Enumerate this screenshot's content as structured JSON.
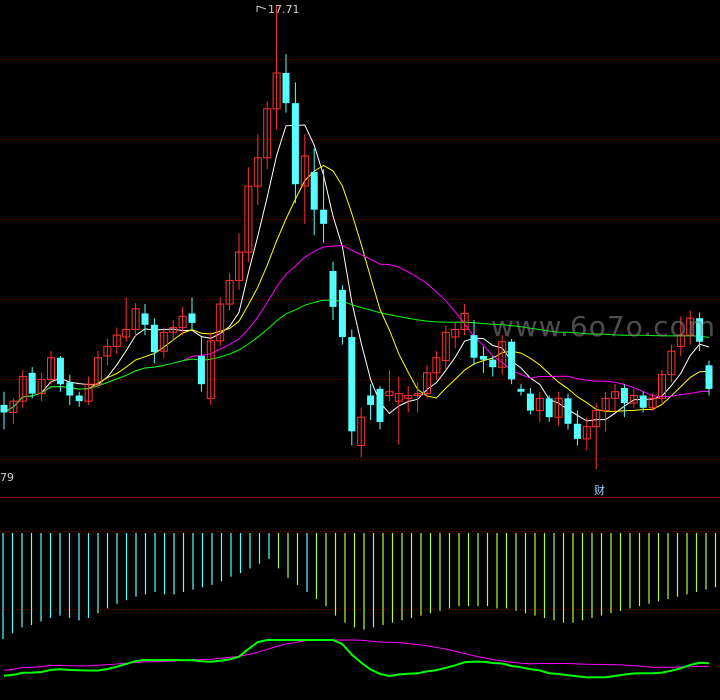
{
  "labels": {
    "high_marker": "17.71",
    "low_marker": "79",
    "event_badge": "财",
    "watermark": "www.6o7o.com"
  },
  "colors": {
    "background": "#000000",
    "grid": "#7a0000",
    "up": "#ff3232",
    "down": "#54ffff",
    "ma5": "#ffffff",
    "ma10": "#ffff00",
    "ma20": "#ff00ff",
    "ma60": "#00ff00",
    "hist_pos": "#adff2f",
    "hist_neg": "#54ffff",
    "sub_line1": "#00ff00",
    "sub_line2": "#ff00ff"
  },
  "chart_data": {
    "type": "candlestick",
    "price_range": [
      12.79,
      17.71
    ],
    "ohlc": [
      [
        13.48,
        13.62,
        13.22,
        13.4
      ],
      [
        13.4,
        13.55,
        13.28,
        13.52
      ],
      [
        13.52,
        13.85,
        13.45,
        13.78
      ],
      [
        13.82,
        13.88,
        13.55,
        13.6
      ],
      [
        13.6,
        13.82,
        13.52,
        13.75
      ],
      [
        13.75,
        14.05,
        13.7,
        13.98
      ],
      [
        13.98,
        14.0,
        13.62,
        13.7
      ],
      [
        13.72,
        13.8,
        13.48,
        13.58
      ],
      [
        13.58,
        13.62,
        13.46,
        13.52
      ],
      [
        13.52,
        13.78,
        13.48,
        13.7
      ],
      [
        13.7,
        14.05,
        13.66,
        13.98
      ],
      [
        14.0,
        14.18,
        13.9,
        14.1
      ],
      [
        14.1,
        14.3,
        14.02,
        14.22
      ],
      [
        14.2,
        14.62,
        14.15,
        14.28
      ],
      [
        14.28,
        14.56,
        14.2,
        14.5
      ],
      [
        14.45,
        14.55,
        14.22,
        14.33
      ],
      [
        14.33,
        14.4,
        13.92,
        14.04
      ],
      [
        14.05,
        14.3,
        13.98,
        14.25
      ],
      [
        14.25,
        14.38,
        14.16,
        14.3
      ],
      [
        14.3,
        14.52,
        14.22,
        14.42
      ],
      [
        14.45,
        14.62,
        14.28,
        14.35
      ],
      [
        14.0,
        14.2,
        13.62,
        13.7
      ],
      [
        13.55,
        14.25,
        13.48,
        14.16
      ],
      [
        14.16,
        14.62,
        14.1,
        14.55
      ],
      [
        14.55,
        14.88,
        14.48,
        14.8
      ],
      [
        14.8,
        15.3,
        14.7,
        15.1
      ],
      [
        15.1,
        16.0,
        15.0,
        15.8
      ],
      [
        15.8,
        16.35,
        15.6,
        16.1
      ],
      [
        16.1,
        16.7,
        15.98,
        16.62
      ],
      [
        16.62,
        17.71,
        16.4,
        17.0
      ],
      [
        17.0,
        17.2,
        16.58,
        16.68
      ],
      [
        16.68,
        16.9,
        15.62,
        15.82
      ],
      [
        15.8,
        16.35,
        15.4,
        16.12
      ],
      [
        15.95,
        16.2,
        15.28,
        15.55
      ],
      [
        15.55,
        15.98,
        15.2,
        15.4
      ],
      [
        14.9,
        15.0,
        14.38,
        14.52
      ],
      [
        14.7,
        14.75,
        14.12,
        14.2
      ],
      [
        14.2,
        14.28,
        13.05,
        13.2
      ],
      [
        13.05,
        13.45,
        12.92,
        13.35
      ],
      [
        13.58,
        13.7,
        13.32,
        13.48
      ],
      [
        13.65,
        13.68,
        13.22,
        13.3
      ],
      [
        13.58,
        13.85,
        13.52,
        13.62
      ],
      [
        13.52,
        13.78,
        13.06,
        13.6
      ],
      [
        13.55,
        13.68,
        13.4,
        13.58
      ],
      [
        13.58,
        13.72,
        13.4,
        13.6
      ],
      [
        13.6,
        13.9,
        13.55,
        13.82
      ],
      [
        13.82,
        14.05,
        13.75,
        13.98
      ],
      [
        13.95,
        14.32,
        13.85,
        14.25
      ],
      [
        14.2,
        14.35,
        14.08,
        14.28
      ],
      [
        14.28,
        14.55,
        14.22,
        14.45
      ],
      [
        14.22,
        14.38,
        13.9,
        13.98
      ],
      [
        14.0,
        14.1,
        13.82,
        13.96
      ],
      [
        13.96,
        14.0,
        13.78,
        13.88
      ],
      [
        13.88,
        14.22,
        13.8,
        14.15
      ],
      [
        14.15,
        14.18,
        13.7,
        13.75
      ],
      [
        13.65,
        13.7,
        13.58,
        13.62
      ],
      [
        13.6,
        13.66,
        13.38,
        13.42
      ],
      [
        13.42,
        13.62,
        13.3,
        13.55
      ],
      [
        13.55,
        13.58,
        13.3,
        13.35
      ],
      [
        13.35,
        13.62,
        13.26,
        13.55
      ],
      [
        13.55,
        13.6,
        13.22,
        13.28
      ],
      [
        13.28,
        13.42,
        13.05,
        13.12
      ],
      [
        13.12,
        13.35,
        13.0,
        13.25
      ],
      [
        13.25,
        13.5,
        12.8,
        13.42
      ],
      [
        13.42,
        13.62,
        13.2,
        13.55
      ],
      [
        13.55,
        13.7,
        13.4,
        13.62
      ],
      [
        13.66,
        13.7,
        13.35,
        13.5
      ],
      [
        13.5,
        13.65,
        13.45,
        13.58
      ],
      [
        13.58,
        13.62,
        13.4,
        13.45
      ],
      [
        13.45,
        13.6,
        13.42,
        13.55
      ],
      [
        13.55,
        13.85,
        13.5,
        13.8
      ],
      [
        13.8,
        14.12,
        13.72,
        14.05
      ],
      [
        14.1,
        14.42,
        14.0,
        14.22
      ],
      [
        14.22,
        14.48,
        14.12,
        14.4
      ],
      [
        14.4,
        14.46,
        14.05,
        14.15
      ],
      [
        13.9,
        13.95,
        13.58,
        13.65
      ]
    ],
    "ma_names": [
      "MA5",
      "MA10",
      "MA20",
      "MA60"
    ],
    "subchart": {
      "type": "histogram+lines",
      "histogram": [
        -0.9,
        -0.85,
        -0.8,
        -0.78,
        -0.75,
        -0.72,
        -0.7,
        -0.72,
        -0.74,
        -0.72,
        -0.68,
        -0.64,
        -0.6,
        -0.57,
        -0.54,
        -0.52,
        -0.5,
        -0.52,
        -0.52,
        -0.5,
        -0.48,
        -0.46,
        -0.44,
        -0.41,
        -0.37,
        -0.34,
        -0.3,
        -0.26,
        -0.22,
        -0.3,
        -0.38,
        -0.44,
        -0.5,
        -0.56,
        -0.62,
        -0.7,
        -0.76,
        -0.8,
        -0.82,
        -0.8,
        -0.78,
        -0.76,
        -0.74,
        -0.72,
        -0.7,
        -0.68,
        -0.66,
        -0.64,
        -0.62,
        -0.62,
        -0.62,
        -0.62,
        -0.64,
        -0.64,
        -0.66,
        -0.68,
        -0.7,
        -0.72,
        -0.74,
        -0.76,
        -0.76,
        -0.74,
        -0.72,
        -0.7,
        -0.68,
        -0.66,
        -0.64,
        -0.62,
        -0.6,
        -0.58,
        -0.56,
        -0.54,
        -0.52,
        -0.5,
        -0.48,
        -0.46
      ],
      "histogram_positive_bars": [
        29,
        30,
        31,
        33,
        34,
        35,
        36,
        37,
        38,
        39,
        40,
        41,
        42,
        43,
        44,
        45,
        46,
        47,
        48,
        49,
        50,
        51,
        52,
        53,
        54,
        55,
        56,
        57,
        58,
        59,
        60,
        61,
        62,
        63,
        64,
        65,
        66,
        67,
        68,
        69,
        70,
        71,
        72,
        73,
        74,
        75
      ]
    }
  }
}
